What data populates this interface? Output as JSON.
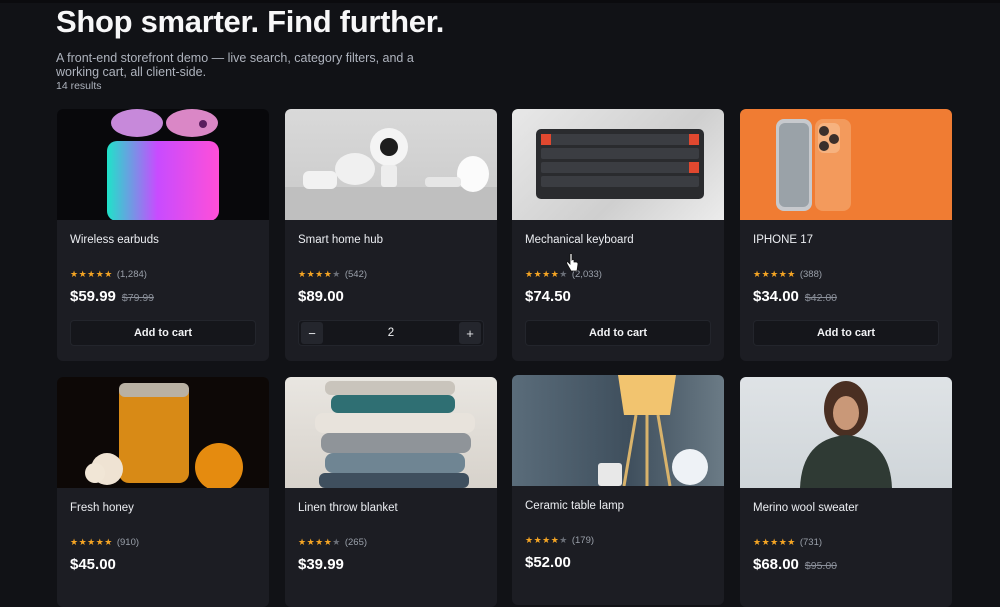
{
  "header": {
    "title": "Shop smarter. Find further.",
    "subtitle": "A front-end storefront demo — live search, category filters, and a working cart, all client-side.",
    "results": "14 results"
  },
  "colors": {
    "background": "#111216",
    "card": "#1c1d23",
    "star": "#f5a524",
    "button": "#15161b"
  },
  "products": [
    {
      "name": "Wireless earbuds",
      "stars": 5,
      "reviews": "(1,284)",
      "price": "$59.99",
      "old_price": "$79.99",
      "cta": "Add to cart"
    },
    {
      "name": "Smart home hub",
      "stars": 4,
      "reviews": "(542)",
      "price": "$89.00",
      "old_price": "",
      "quantity": "2",
      "minus": "−",
      "plus": "+"
    },
    {
      "name": "Mechanical keyboard",
      "stars": 4,
      "reviews": "(2,033)",
      "price": "$74.50",
      "old_price": "",
      "cta": "Add to cart"
    },
    {
      "name": "IPHONE 17",
      "stars": 5,
      "reviews": "(388)",
      "price": "$34.00",
      "old_price": "$42.00",
      "cta": "Add to cart"
    },
    {
      "name": "Fresh honey",
      "stars": 5,
      "reviews": "(910)",
      "price": "$45.00",
      "old_price": ""
    },
    {
      "name": "Linen throw blanket",
      "stars": 4,
      "reviews": "(265)",
      "price": "$39.99",
      "old_price": ""
    },
    {
      "name": "Ceramic table lamp",
      "stars": 4,
      "reviews": "(179)",
      "price": "$52.00",
      "old_price": ""
    },
    {
      "name": "Merino wool sweater",
      "stars": 5,
      "reviews": "(731)",
      "price": "$68.00",
      "old_price": "$95.00"
    }
  ],
  "icons": [
    "star-icon",
    "minus-icon",
    "plus-icon",
    "pointer-cursor-icon"
  ]
}
